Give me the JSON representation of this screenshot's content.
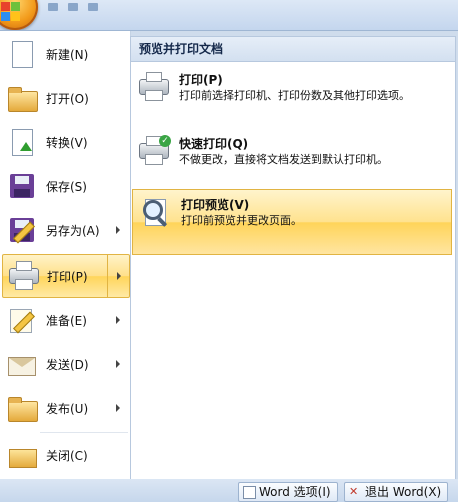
{
  "left_menu": {
    "items": [
      {
        "label": "新建(N)",
        "icon": "new-document-icon"
      },
      {
        "label": "打开(O)",
        "icon": "open-folder-icon"
      },
      {
        "label": "转换(V)",
        "icon": "convert-icon"
      },
      {
        "label": "保存(S)",
        "icon": "save-disk-icon"
      },
      {
        "label": "另存为(A)",
        "icon": "save-as-icon"
      },
      {
        "label": "打印(P)",
        "icon": "printer-icon"
      },
      {
        "label": "准备(E)",
        "icon": "prepare-icon"
      },
      {
        "label": "发送(D)",
        "icon": "send-icon"
      },
      {
        "label": "发布(U)",
        "icon": "publish-icon"
      },
      {
        "label": "关闭(C)",
        "icon": "close-folder-icon"
      }
    ],
    "active": "打印(P)"
  },
  "print_panel": {
    "header": "预览并打印文档",
    "items": [
      {
        "title": "打印(P)",
        "description": "打印前选择打印机、打印份数及其他打印选项。"
      },
      {
        "title": "快速打印(Q)",
        "description": "不做更改，直接将文档发送到默认打印机。"
      },
      {
        "title": "打印预览(V)",
        "description": "打印前预览并更改页面。"
      }
    ],
    "highlighted": "打印预览(V)"
  },
  "bottom_bar": {
    "options_label": "Word 选项(I)",
    "exit_label": "退出 Word(X)"
  },
  "colors": {
    "highlight": "#ffe08a",
    "highlight_border": "#e1b443",
    "panel_header": "#d3e0f0",
    "frame": "#cfdcec"
  }
}
